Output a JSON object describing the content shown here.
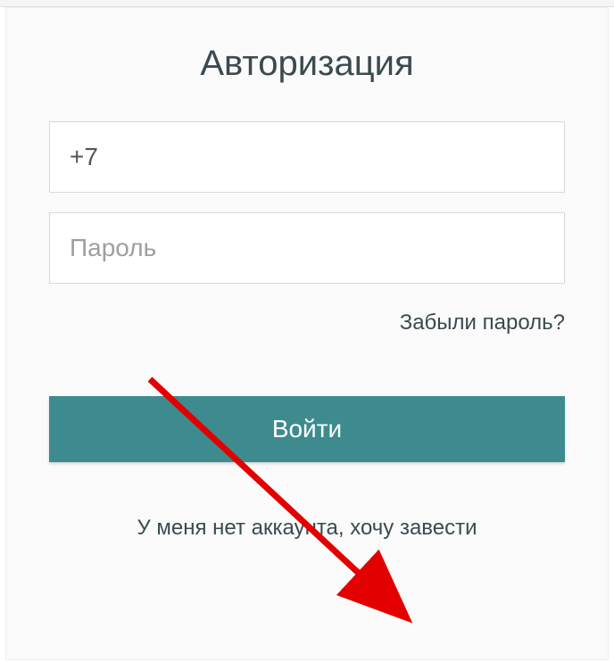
{
  "form": {
    "title": "Авторизация",
    "phone_value": "+7",
    "password_placeholder": "Пароль",
    "forgot_password_label": "Забыли пароль?",
    "login_button_label": "Войти",
    "signup_link_label": "У меня нет аккаунта, хочу завести"
  }
}
